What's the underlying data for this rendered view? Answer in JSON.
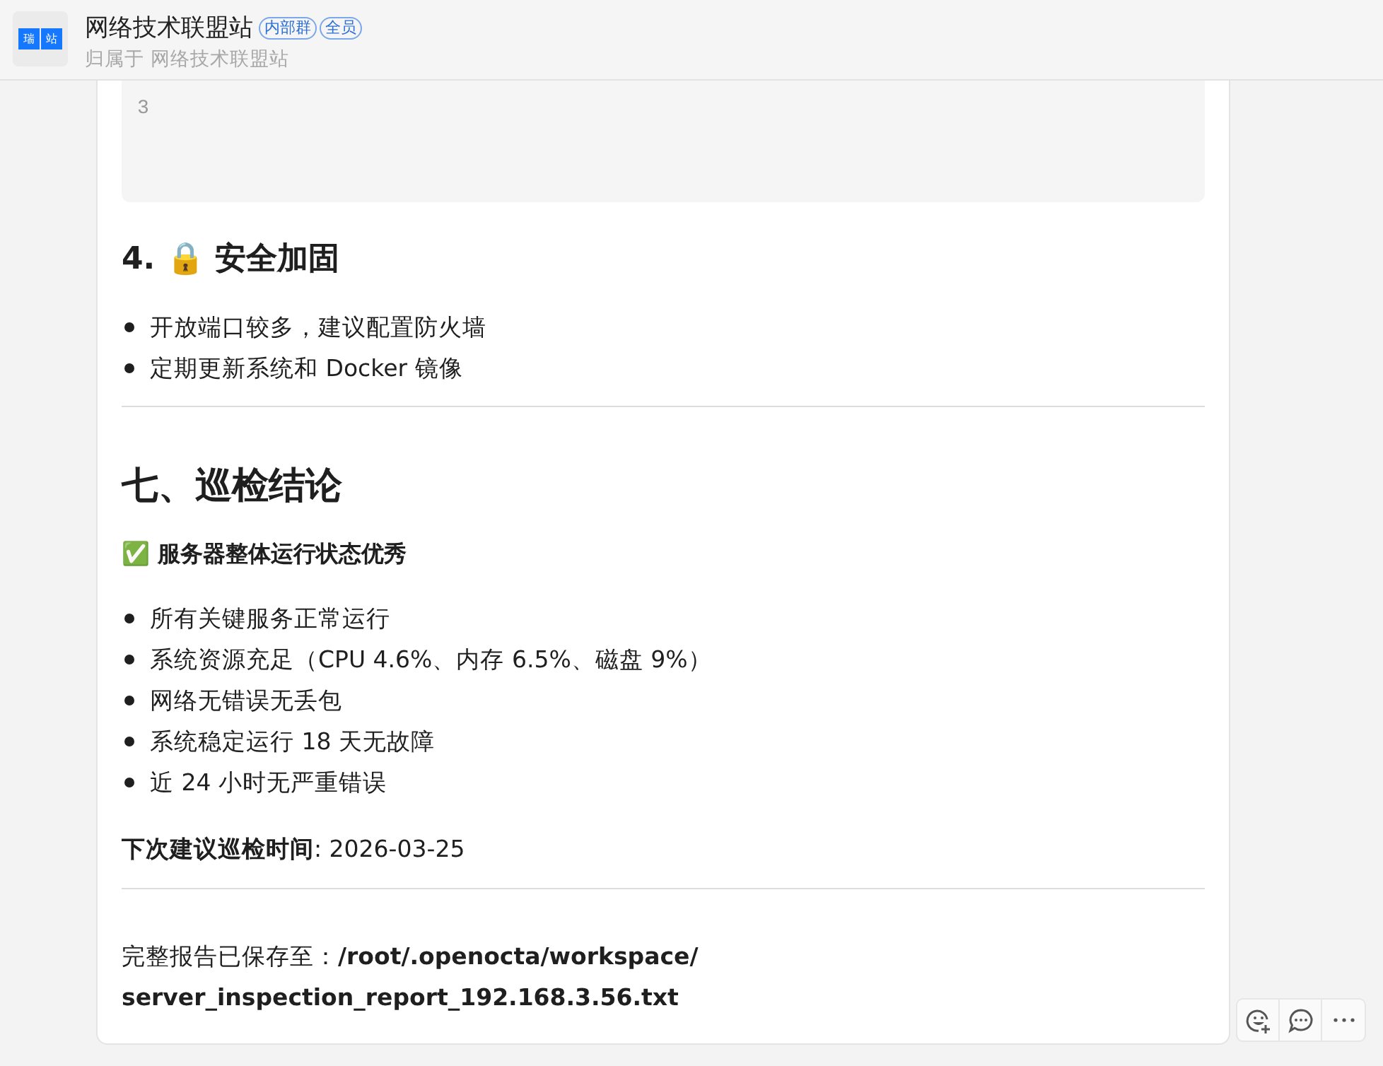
{
  "header": {
    "logo": [
      "瑞",
      "站"
    ],
    "title": "网络技术联盟站",
    "tags": [
      "内部群",
      "全员"
    ],
    "subtitle": "归属于 网络技术联盟站"
  },
  "code_block": {
    "lines": [
      {
        "number": "3"
      }
    ]
  },
  "content": [
    {
      "kind": "h3",
      "text": "4. 🔒 安全加固"
    },
    {
      "kind": "list",
      "items": [
        "开放端口较多，建议配置防火墙",
        "定期更新系统和 Docker 镜像"
      ]
    },
    {
      "kind": "rule"
    },
    {
      "kind": "h2",
      "text": "七、巡检结论"
    },
    {
      "kind": "strong",
      "text": "✅ 服务器整体运行状态优秀"
    },
    {
      "kind": "list",
      "items": [
        "所有关键服务正常运行",
        "系统资源充足（CPU 4.6%、内存 6.5%、磁盘 9%）",
        "网络无错误无丢包",
        "系统稳定运行 18 天无故障",
        "近 24 小时无严重错误"
      ]
    },
    {
      "kind": "para",
      "text": "**下次建议巡检时间**: 2026-03-25"
    },
    {
      "kind": "rule"
    },
    {
      "kind": "para",
      "text": "完整报告已保存至：**/root/.openocta/workspace/**"
    },
    {
      "kind": "para",
      "text": "**server_inspection_report_192.168.3.56.txt**"
    }
  ],
  "actions": [
    {
      "kind": "react"
    },
    {
      "kind": "reply"
    },
    {
      "kind": "more"
    }
  ]
}
